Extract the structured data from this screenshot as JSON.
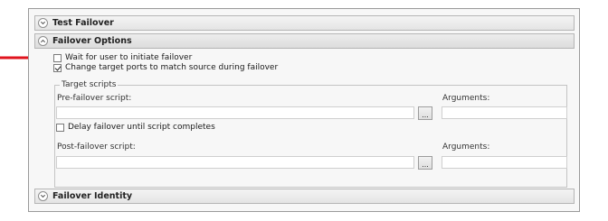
{
  "sections": {
    "test_failover": "Test Failover",
    "failover_options": "Failover Options",
    "failover_identity": "Failover Identity"
  },
  "options": {
    "wait_for_user": {
      "label": "Wait for user to initiate failover",
      "checked": false
    },
    "change_ports": {
      "label": "Change target ports to match source during failover",
      "checked": true
    }
  },
  "target_scripts": {
    "legend": "Target scripts",
    "pre_failover_label": "Pre-failover script:",
    "pre_failover_value": "",
    "pre_args_label": "Arguments:",
    "pre_args_value": "",
    "browse_label": "...",
    "delay": {
      "label": "Delay failover until script completes",
      "checked": false
    },
    "post_failover_label": "Post-failover script:",
    "post_failover_value": "",
    "post_args_label": "Arguments:",
    "post_args_value": ""
  },
  "annotation": {
    "arrow_color": "#e0141e"
  }
}
